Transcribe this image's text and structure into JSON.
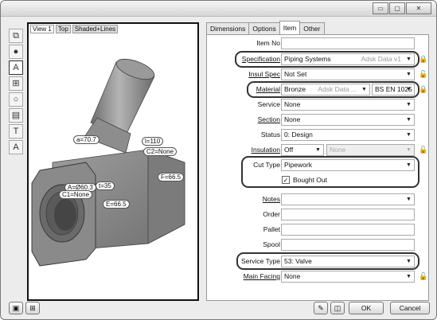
{
  "window": {
    "controls": {
      "minimize": "▭",
      "maximize": "▢",
      "close": "✕"
    }
  },
  "left_toolbar": {
    "tools": [
      {
        "name": "view-orient-icon",
        "glyph": "⧉"
      },
      {
        "name": "sphere-icon",
        "glyph": "●"
      },
      {
        "name": "annotate-icon",
        "glyph": "A"
      },
      {
        "name": "fit-view-icon",
        "glyph": "⊞"
      },
      {
        "name": "sphere-outline-icon",
        "glyph": "○"
      },
      {
        "name": "report-icon",
        "glyph": "▤"
      },
      {
        "name": "tee-icon",
        "glyph": "T"
      },
      {
        "name": "spellcheck-icon",
        "glyph": "A"
      }
    ]
  },
  "viewport": {
    "tabs": [
      "View 1",
      "Top",
      "Shaded+Lines"
    ],
    "dimensions": {
      "a": "a=70.7",
      "l": "l=110",
      "c2": "C2=None",
      "f": "F=66.5",
      "A": "A=Ø60.3",
      "t": "t=35",
      "c1": "C1=None",
      "e": "E=66.5"
    }
  },
  "properties": {
    "tabs": [
      "Dimensions",
      "Options",
      "Item",
      "Other"
    ],
    "selected_tab": "Item",
    "fields": {
      "item_no": {
        "label": "Item No",
        "value": ""
      },
      "specification": {
        "label": "Specification",
        "value": "Piping Systems",
        "hint": "Adsk Data v1"
      },
      "insul_spec": {
        "label": "Insul Spec",
        "value": "Not Set"
      },
      "material": {
        "label": "Material",
        "value": "Bronze",
        "hint": "Adsk Data ...",
        "grade": "BS EN 1025"
      },
      "service": {
        "label": "Service",
        "value": "None"
      },
      "section": {
        "label": "Section",
        "value": "None"
      },
      "status": {
        "label": "Status",
        "value": "0: Design"
      },
      "insulation": {
        "label": "Insulation",
        "value": "Off",
        "secondary": "None"
      },
      "cut_type": {
        "label": "Cut Type",
        "value": "Pipework"
      },
      "bought_out": {
        "label": "Bought Out",
        "checked": true
      },
      "notes": {
        "label": "Notes",
        "value": ""
      },
      "order": {
        "label": "Order",
        "value": ""
      },
      "pallet": {
        "label": "Pallet",
        "value": ""
      },
      "spool": {
        "label": "Spool",
        "value": ""
      },
      "service_type": {
        "label": "Service Type",
        "value": "53: Valve"
      },
      "main_facing": {
        "label": "Main Facing",
        "value": "None"
      }
    }
  },
  "footer": {
    "ok": "OK",
    "cancel": "Cancel"
  },
  "colors": {
    "highlight": "#333333",
    "window_bg": "#ececec",
    "fitting_shade": "#8a8a8a"
  }
}
